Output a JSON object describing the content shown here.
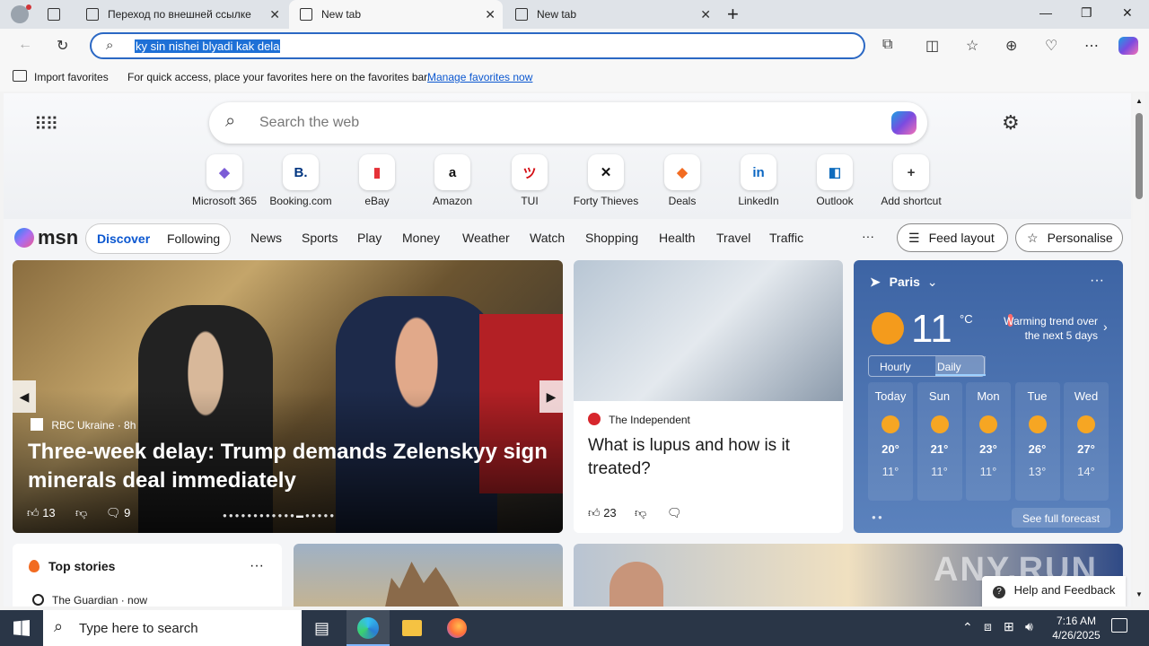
{
  "tabs": [
    {
      "label": "Переход по внешней ссылке"
    },
    {
      "label": "New tab"
    },
    {
      "label": "New tab"
    }
  ],
  "address_bar": {
    "value": "ky sin nishei blyadi kak dela"
  },
  "favorites_bar": {
    "import_label": "Import favorites",
    "hint": "For quick access, place your favorites here on the favorites bar.",
    "manage_link": "Manage favorites now"
  },
  "search": {
    "placeholder": "Search the web"
  },
  "shortcuts": [
    {
      "label": "Microsoft 365",
      "glyph": "◆",
      "color": "#7b5cd6"
    },
    {
      "label": "Booking.com",
      "glyph": "B.",
      "color": "#003580"
    },
    {
      "label": "eBay",
      "glyph": "▮",
      "color": "#e53238"
    },
    {
      "label": "Amazon",
      "glyph": "a",
      "color": "#111111"
    },
    {
      "label": "TUI",
      "glyph": "ツ",
      "color": "#d40e14"
    },
    {
      "label": "Forty Thieves",
      "glyph": "✕",
      "color": "#111111"
    },
    {
      "label": "Deals",
      "glyph": "◆",
      "color": "#f26b21"
    },
    {
      "label": "LinkedIn",
      "glyph": "in",
      "color": "#0a66c2"
    },
    {
      "label": "Outlook",
      "glyph": "◧",
      "color": "#0f6cbd"
    },
    {
      "label": "Add shortcut",
      "glyph": "+",
      "color": "#333333"
    }
  ],
  "msn": {
    "logo": "msn",
    "feed_tabs": [
      "Discover",
      "Following"
    ],
    "nav": [
      "News",
      "Sports",
      "Play",
      "Money",
      "Weather",
      "Watch",
      "Shopping",
      "Health",
      "Travel",
      "Traffic"
    ],
    "more": "···",
    "feed_layout": "Feed layout",
    "personalise": "Personalise"
  },
  "hero": {
    "source": "RBC Ukraine",
    "age": "8h",
    "headline": "Three-week delay: Trump demands Zelenskyy sign minerals deal immediately",
    "likes": "13",
    "comments": "9"
  },
  "lupus": {
    "source": "The Independent",
    "headline": "What is lupus and how is it treated?",
    "likes": "23"
  },
  "weather": {
    "city": "Paris",
    "temp": "11",
    "unit": "°C",
    "trend": "Warming trend over the next 5 days",
    "tabs": [
      "Hourly",
      "Daily"
    ],
    "days": [
      {
        "day": "Today",
        "hi": "20°",
        "lo": "11°"
      },
      {
        "day": "Sun",
        "hi": "21°",
        "lo": "11°"
      },
      {
        "day": "Mon",
        "hi": "23°",
        "lo": "11°"
      },
      {
        "day": "Tue",
        "hi": "26°",
        "lo": "13°"
      },
      {
        "day": "Wed",
        "hi": "27°",
        "lo": "14°"
      }
    ],
    "forecast_link": "See full forecast"
  },
  "top_stories": {
    "title": "Top stories",
    "source": "The Guardian · now"
  },
  "help": {
    "label": "Help and Feedback"
  },
  "taskbar": {
    "search_placeholder": "Type here to search",
    "time": "7:16 AM",
    "date": "4/26/2025"
  }
}
